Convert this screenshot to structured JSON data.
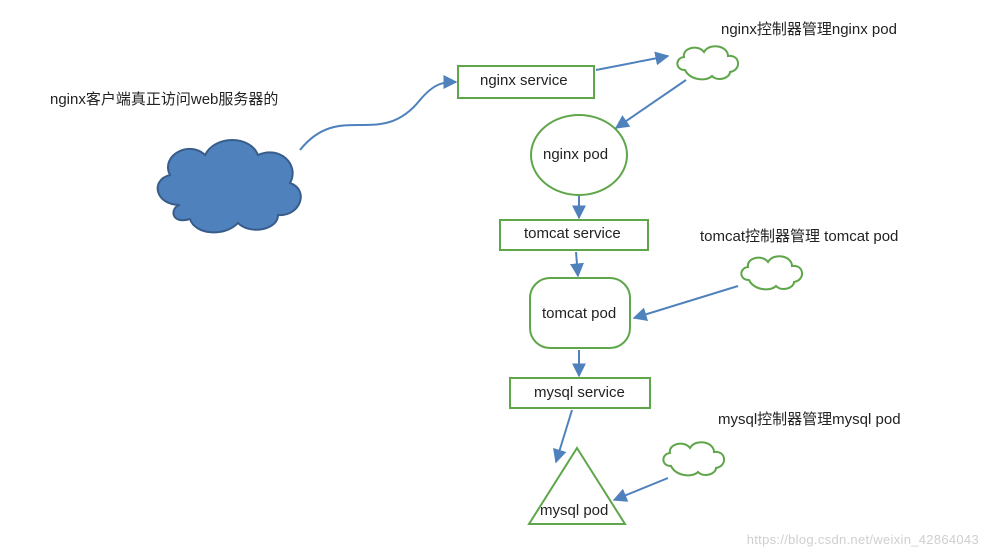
{
  "labels": {
    "client": "nginx客户端真正访问web服务器的",
    "nginx_controller": "nginx控制器管理nginx pod",
    "tomcat_controller": "tomcat控制器管理 tomcat pod",
    "mysql_controller": "mysql控制器管理mysql pod"
  },
  "nodes": {
    "nginx_service": "nginx service",
    "nginx_pod": "nginx   pod",
    "tomcat_service": "tomcat service",
    "tomcat_pod": "tomcat pod",
    "mysql_service": "mysql service",
    "mysql_pod": "mysql  pod"
  },
  "watermark": "https://blog.csdn.net/weixin_42864043",
  "colors": {
    "shape_green": "#5fa64a",
    "arrow_blue": "#4f81bd",
    "cloud_fill": "#4f81bd",
    "cloud_border": "#385d8a"
  }
}
